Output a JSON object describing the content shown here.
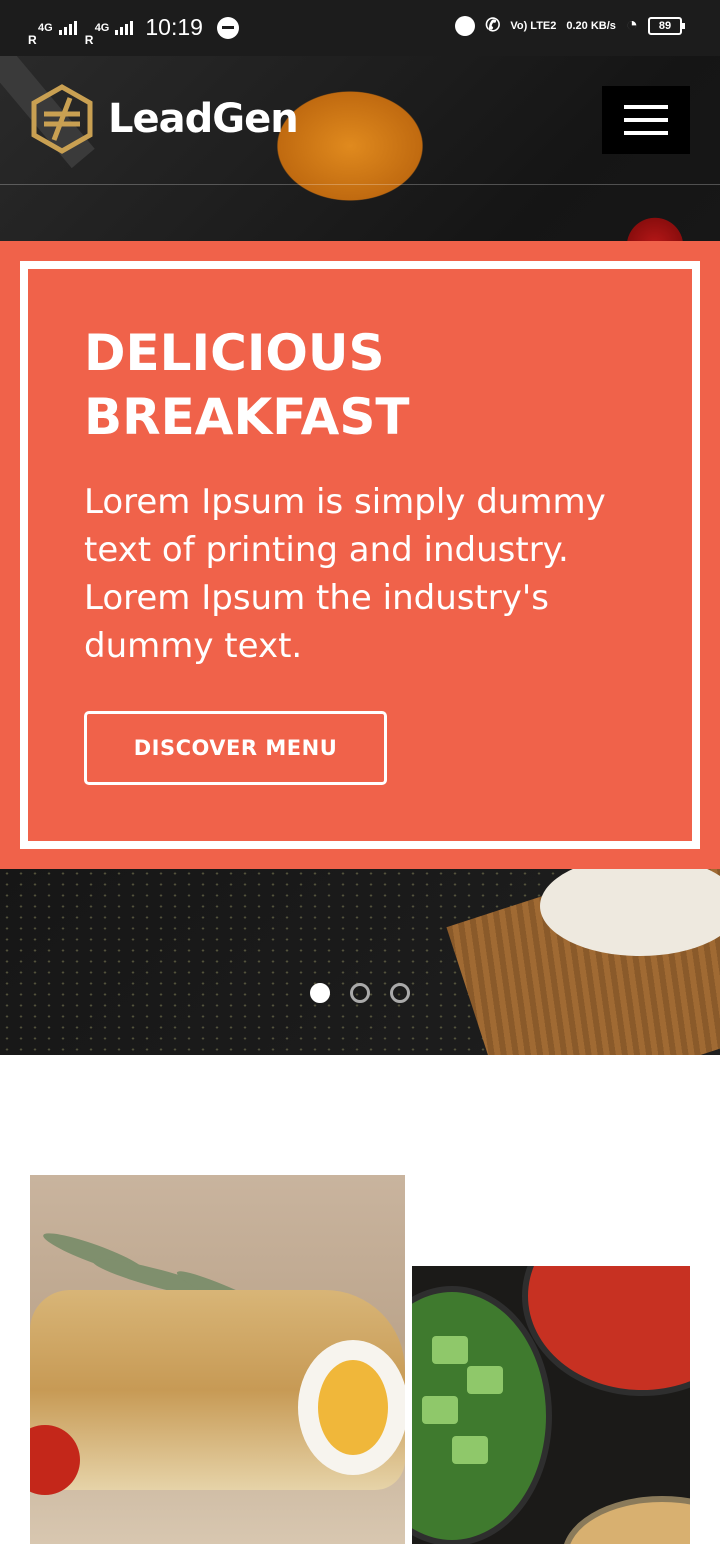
{
  "status_bar": {
    "network_1": "4G",
    "roaming_1": "R",
    "network_2": "4G",
    "roaming_2": "R",
    "time": "10:19",
    "volte": "Vo) LTE2",
    "speed": "0.20 KB/s",
    "battery": "89"
  },
  "header": {
    "logo_text": "LeadGen",
    "menu_icon": "hamburger-icon"
  },
  "hero": {
    "title": "DELICIOUS BREAKFAST",
    "description": "Lorem Ipsum is simply dummy text of printing and industry. Lorem Ipsum the industry's dummy text.",
    "cta_label": "DISCOVER MENU",
    "slides": 3,
    "active_slide": 1
  },
  "colors": {
    "accent": "#f0624a",
    "logo_gold": "#c9a052",
    "status_bar": "#1c1c1c"
  }
}
